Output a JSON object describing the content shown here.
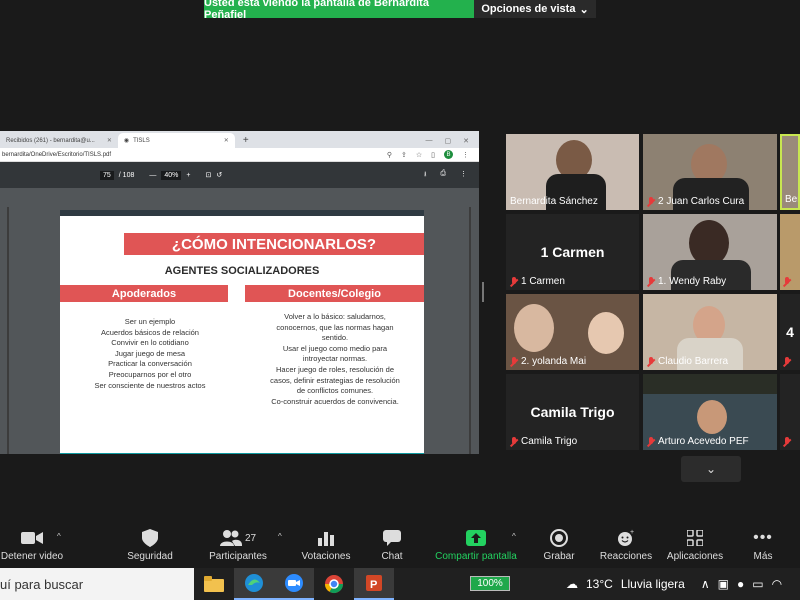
{
  "banner": {
    "message": "Usted está viendo la pantalla de Bernardita Peñafiel",
    "options": "Opciones de vista"
  },
  "browser": {
    "tabs": [
      {
        "label": "Recibidos (261) - bernardita@u..."
      },
      {
        "label": "TISLS"
      }
    ],
    "address": "bernardita/OneDrive/Escritorio/TISLS.pdf",
    "avatar_letter": "B",
    "pdf": {
      "page": "75",
      "total": "/ 108",
      "zoom": "40%"
    }
  },
  "slide": {
    "title": "¿CÓMO INTENCIONARLOS?",
    "subtitle": "AGENTES SOCIALIZADORES",
    "left_header": "Apoderados",
    "right_header": "Docentes/Colegio",
    "left_items": [
      "Ser un ejemplo",
      "Acuerdos básicos de relación",
      "Convivir en lo cotidiano",
      "Jugar juego de mesa",
      "Practicar la conversación",
      "Preocuparnos por el otro",
      "Ser consciente de nuestros actos"
    ],
    "right_items": [
      "Volver a lo básico: saludarnos,",
      "conocernos, que las normas hagan",
      "sentido.",
      "Usar el juego como medio para",
      "introyectar normas.",
      "Hacer juego de roles, resolución de",
      "casos, definir estrategias de resolución",
      "de conflictos comunes.",
      "Co-construir acuerdos de convivencia."
    ]
  },
  "participants": {
    "p1": "Bernardita Sánchez",
    "p2": "2 Juan Carlos Cura",
    "p3_partial": "Ber",
    "p4_big": "1 Carmen",
    "p4": "1 Carmen",
    "p5": "1. Wendy Raby",
    "p7": "2. yolanda Mai",
    "p8": "Claudio Barrera",
    "p9_partial": "4",
    "p10_big": "Camila Trigo",
    "p10": "Camila Trigo",
    "p11": "Arturo Acevedo PEF"
  },
  "toolbar": {
    "video": "Detener video",
    "security": "Seguridad",
    "participants": "Participantes",
    "participants_count": "27",
    "polls": "Votaciones",
    "chat": "Chat",
    "share": "Compartir pantalla",
    "record": "Grabar",
    "reactions": "Reacciones",
    "apps": "Aplicaciones",
    "more": "Más"
  },
  "taskbar": {
    "search": "uí para buscar",
    "battery": "100%",
    "temperature": "13°C",
    "weather": "Lluvia ligera"
  },
  "colors": {
    "accent_green": "#23b14d",
    "slide_red": "#e05555",
    "slide_teal": "#0f9aa0"
  }
}
